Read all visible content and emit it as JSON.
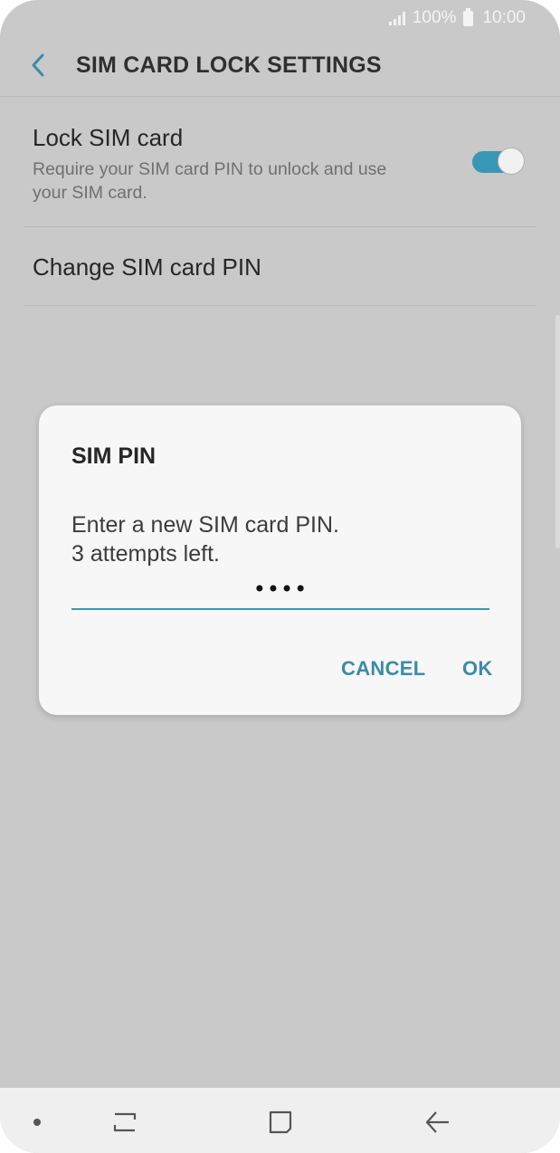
{
  "status_bar": {
    "battery": "100%",
    "time": "10:00",
    "icons": [
      "signal-icon",
      "battery-icon"
    ]
  },
  "app_bar": {
    "title": "SIM CARD LOCK SETTINGS",
    "back_icon": "back-arrow-icon"
  },
  "settings": {
    "lock_sim": {
      "title": "Lock SIM card",
      "subtitle": "Require your SIM card PIN to unlock and use your SIM card.",
      "toggle_on": true
    },
    "change_pin": {
      "title": "Change SIM card PIN"
    }
  },
  "dialog": {
    "title": "SIM PIN",
    "message_line1": "Enter a new SIM card PIN.",
    "message_line2": "3 attempts left.",
    "pin_value": "••••",
    "cancel_label": "CANCEL",
    "ok_label": "OK"
  },
  "nav_bar": {
    "items": [
      "dot-icon",
      "recent-apps-icon",
      "home-icon",
      "back-icon"
    ]
  },
  "colors": {
    "accent": "#3a97b3",
    "scrim_background": "#c9c9c9",
    "dialog_background": "#f7f7f7"
  }
}
